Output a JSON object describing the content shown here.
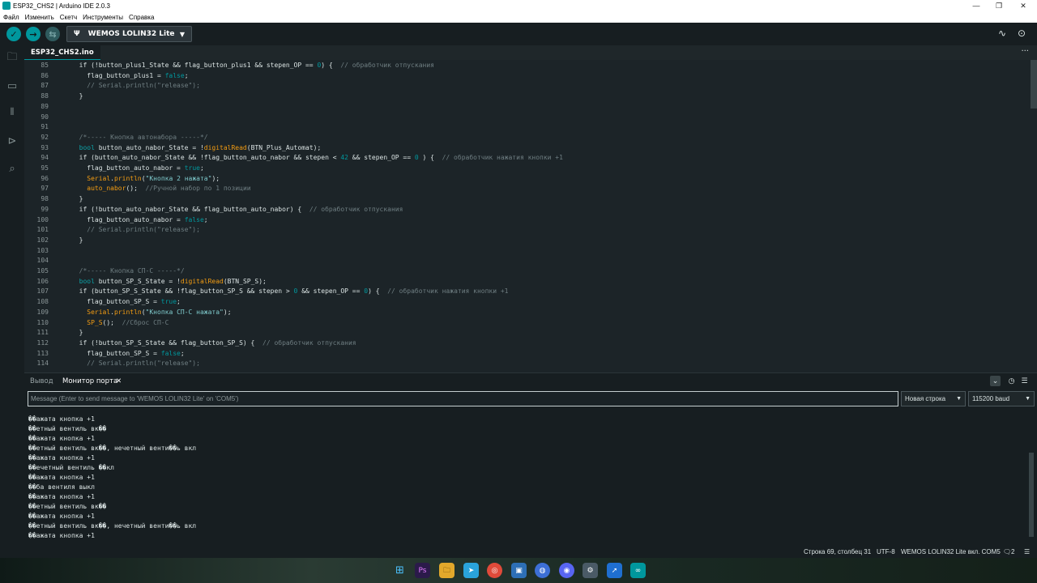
{
  "window": {
    "title": "ESP32_CHS2 | Arduino IDE 2.0.3",
    "controls": [
      "—",
      "❐",
      "✕"
    ]
  },
  "menu": [
    "Файл",
    "Изменить",
    "Скетч",
    "Инструменты",
    "Справка"
  ],
  "toolbar": {
    "verify_icon": "✓",
    "upload_icon": "→",
    "debug_icon": "⇆",
    "board_usb_icon": "Ψ",
    "board": "WEMOS LOLIN32 Lite",
    "board_caret": "▼",
    "plotter_icon": "∿",
    "monitor_icon": "⊙"
  },
  "sidebar_icons": [
    "🗀",
    "▭",
    "𝍪",
    "⊳",
    "⌕"
  ],
  "tab": {
    "file": "ESP32_CHS2.ino",
    "more": "···"
  },
  "code": [
    {
      "n": "85",
      "html": "  if (!button_plus1_State &amp;&amp; flag_button_plus1 &amp;&amp; stepen_OP == <span class=\"lit\">0</span>) {  <span class=\"cm\">// обработчик отпускания</span>"
    },
    {
      "n": "86",
      "html": "    flag_button_plus1 = <span class=\"lit\">false</span>;"
    },
    {
      "n": "87",
      "html": "    <span class=\"cm\">// Serial.println(\"release\");</span>"
    },
    {
      "n": "88",
      "html": "  }"
    },
    {
      "n": "89",
      "html": ""
    },
    {
      "n": "90",
      "html": ""
    },
    {
      "n": "91",
      "html": ""
    },
    {
      "n": "92",
      "html": "  <span class=\"cm\">/*----- Кнопка автонабора -----*/</span>"
    },
    {
      "n": "93",
      "html": "  <span class=\"kw\">bool</span> button_auto_nabor_State = !<span class=\"fn\">digitalRead</span>(BTN_Plus_Automat);"
    },
    {
      "n": "94",
      "html": "  if (button_auto_nabor_State &amp;&amp; !flag_button_auto_nabor &amp;&amp; stepen &lt; <span class=\"lit\">42</span> &amp;&amp; stepen_OP == <span class=\"lit\">0</span> ) {  <span class=\"cm\">// обработчик нажатия кнопки +1</span>"
    },
    {
      "n": "95",
      "html": "    flag_button_auto_nabor = <span class=\"lit\">true</span>;"
    },
    {
      "n": "96",
      "html": "    <span class=\"fn\">Serial</span>.<span class=\"fn\">println</span>(<span class=\"str\">\"Кнопка 2 нажата\"</span>);"
    },
    {
      "n": "97",
      "html": "    <span class=\"fn\">auto_nabor</span>();  <span class=\"cm\">//Ручной набор по 1 позиции</span>"
    },
    {
      "n": "98",
      "html": "  }"
    },
    {
      "n": "99",
      "html": "  if (!button_auto_nabor_State &amp;&amp; flag_button_auto_nabor) {  <span class=\"cm\">// обработчик отпускания</span>"
    },
    {
      "n": "100",
      "html": "    flag_button_auto_nabor = <span class=\"lit\">false</span>;"
    },
    {
      "n": "101",
      "html": "    <span class=\"cm\">// Serial.println(\"release\");</span>"
    },
    {
      "n": "102",
      "html": "  }"
    },
    {
      "n": "103",
      "html": ""
    },
    {
      "n": "104",
      "html": ""
    },
    {
      "n": "105",
      "html": "  <span class=\"cm\">/*----- Кнопка СП-С -----*/</span>"
    },
    {
      "n": "106",
      "html": "  <span class=\"kw\">bool</span> button_SP_S_State = !<span class=\"fn\">digitalRead</span>(BTN_SP_S);"
    },
    {
      "n": "107",
      "html": "  if (button_SP_S_State &amp;&amp; !flag_button_SP_S &amp;&amp; stepen &gt; <span class=\"lit\">0</span> &amp;&amp; stepen_OP == <span class=\"lit\">0</span>) {  <span class=\"cm\">// обработчик нажатия кнопки +1</span>"
    },
    {
      "n": "108",
      "html": "    flag_button_SP_S = <span class=\"lit\">true</span>;"
    },
    {
      "n": "109",
      "html": "    <span class=\"fn\">Serial</span>.<span class=\"fn\">println</span>(<span class=\"str\">\"Кнопка СП-С нажата\"</span>);"
    },
    {
      "n": "110",
      "html": "    <span class=\"fn\">SP_S</span>();  <span class=\"cm\">//Сброс СП-С</span>"
    },
    {
      "n": "111",
      "html": "  }"
    },
    {
      "n": "112",
      "html": "  if (!button_SP_S_State &amp;&amp; flag_button_SP_S) {  <span class=\"cm\">// обработчик отпускания</span>"
    },
    {
      "n": "113",
      "html": "    flag_button_SP_S = <span class=\"lit\">false</span>;"
    },
    {
      "n": "114",
      "html": "    <span class=\"cm\">// Serial.println(\"release\");</span>"
    }
  ],
  "panel": {
    "tab_output": "Вывод",
    "tab_monitor": "Монитор порта",
    "tab_close": "✕",
    "icons": [
      "⌄",
      "◷",
      "☰"
    ]
  },
  "serial": {
    "placeholder": "Message (Enter to send message to 'WEMOS LOLIN32 Lite' on 'COM5')",
    "line_ending": "Новая строка",
    "baud": "115200 baud",
    "caret": "▼",
    "lines": [
      "��ажата кнопка +1",
      "��етный вентиль вк��",
      "��ажата кнопка +1",
      "��етный вентиль вк��, нечетный венти��ь вкл",
      "��ажата кнопка +1",
      "��ечетный вентиль ��кл",
      "��ажата кнопка +1",
      "��ба вентиля выкл",
      "��ажата кнопка +1",
      "��етный вентиль вк��",
      "��ажата кнопка +1",
      "��етный вентиль вк��, нечетный венти��ь вкл",
      "��ажата кнопка +1"
    ]
  },
  "status": {
    "position": "Строка 69, столбец 31",
    "encoding": "UTF-8",
    "board_port": "WEMOS LOLIN32 Lite вкл. COM5",
    "notifications": "2",
    "notif_icon": "🗨",
    "menu_icon": "☰"
  },
  "taskbar": [
    "⊞",
    "Ps",
    "🗀",
    "➤",
    "◎",
    "▣",
    "◍",
    "◉",
    "⚙",
    "➚",
    "∞"
  ],
  "colors": {
    "accent": "#00979d",
    "background": "#171e21",
    "editor_bg": "#1c2428"
  }
}
